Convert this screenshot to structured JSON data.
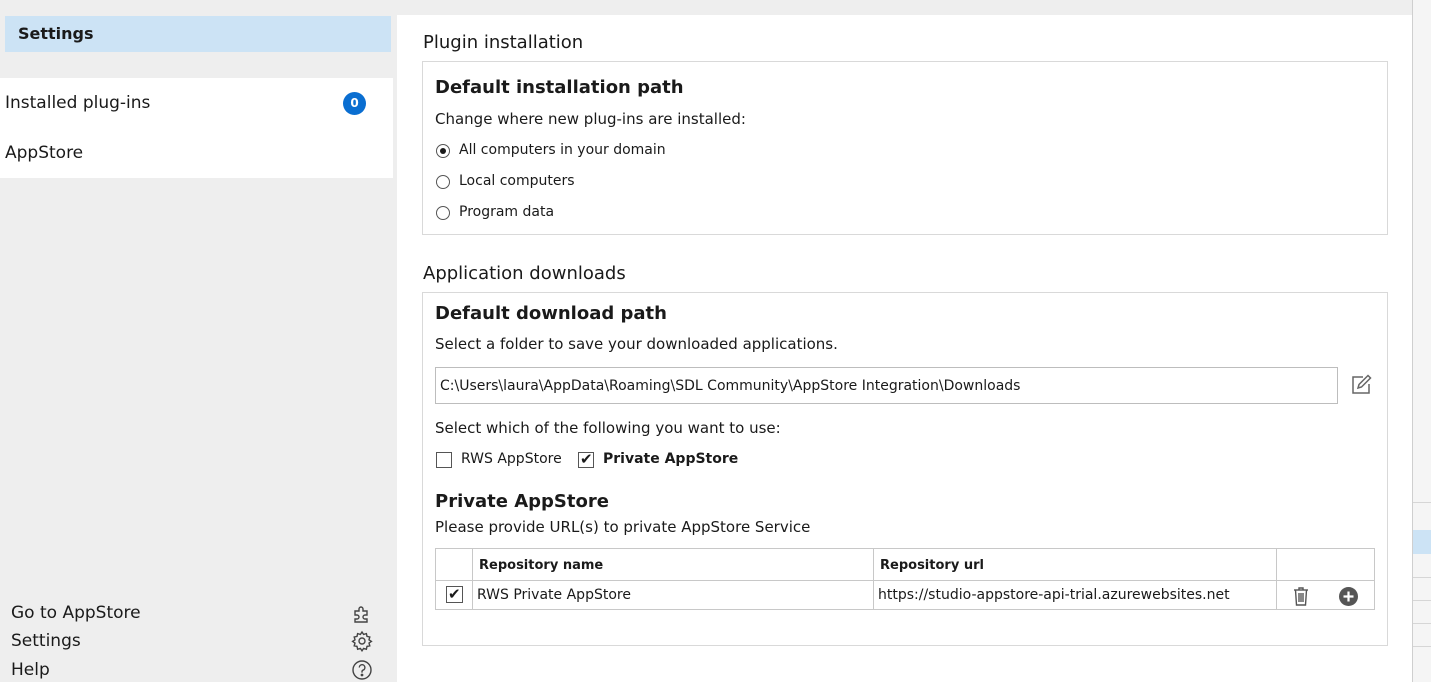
{
  "sidebar": {
    "header": "Settings",
    "items": [
      {
        "label": "Installed plug-ins",
        "badge": "0"
      },
      {
        "label": "AppStore"
      }
    ],
    "bottom": [
      {
        "label": "Go to AppStore",
        "icon": "puzzle-icon"
      },
      {
        "label": "Settings",
        "icon": "gear-icon"
      },
      {
        "label": "Help",
        "icon": "help-icon"
      }
    ]
  },
  "plugin_installation": {
    "section_title": "Plugin installation",
    "panel_title": "Default installation path",
    "description": "Change where new plug-ins are installed:",
    "options": [
      {
        "label": "All computers in your domain",
        "selected": true
      },
      {
        "label": "Local computers",
        "selected": false
      },
      {
        "label": "Program data",
        "selected": false
      }
    ]
  },
  "application_downloads": {
    "section_title": "Application downloads",
    "panel_title": "Default download path",
    "description": "Select a folder to save your downloaded applications.",
    "path_value": "C:\\Users\\laura\\AppData\\Roaming\\SDL Community\\AppStore Integration\\Downloads",
    "select_text": "Select which of the following you want to use:",
    "sources": [
      {
        "label": "RWS AppStore",
        "checked": false
      },
      {
        "label": "Private AppStore",
        "checked": true
      }
    ],
    "private_title": "Private AppStore",
    "private_description": "Please provide URL(s) to private AppStore Service",
    "table": {
      "headers": [
        "Repository name",
        "Repository url"
      ],
      "rows": [
        {
          "checked": true,
          "name": "RWS Private AppStore",
          "url": "https://studio-appstore-api-trial.azurewebsites.net"
        }
      ]
    }
  },
  "colors": {
    "accent": "#0a6ed1",
    "selection": "#cce3f5",
    "sidebar_bg": "#eeeeee"
  }
}
